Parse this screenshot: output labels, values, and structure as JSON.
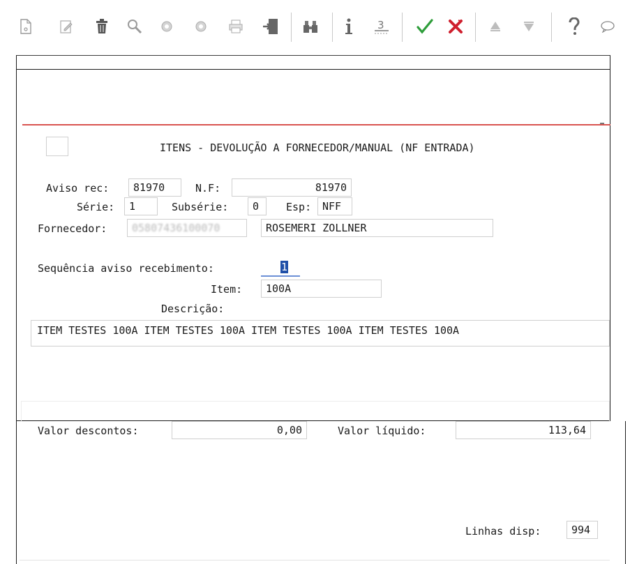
{
  "toolbar": {
    "icons": [
      "new-document-icon",
      "edit-icon",
      "delete-icon",
      "search-icon",
      "previous-icon",
      "next-icon",
      "print-icon",
      "exit-icon",
      "binoculars-icon",
      "info-icon",
      "list-icon",
      "confirm-icon",
      "cancel-icon",
      "move-up-icon",
      "move-down-icon",
      "help-icon",
      "chat-icon"
    ],
    "colors": {
      "confirm": "#2e9d3a",
      "cancel": "#cf1f2e",
      "icon_gray": "#8a8a8a"
    }
  },
  "form": {
    "title": "ITENS - DEVOLUÇÃO A FORNECEDOR/MANUAL (NF ENTRADA)",
    "aviso_rec_label": "Aviso rec:",
    "aviso_rec_value": "81970",
    "nf_label": "N.F:",
    "nf_value": "81970",
    "serie_label": "Série:",
    "serie_value": "1",
    "subserie_label": "Subsérie:",
    "subserie_value": "0",
    "esp_label": "Esp:",
    "esp_value": "NFF",
    "fornecedor_label": "Fornecedor:",
    "fornecedor_code": "05807436100070",
    "fornecedor_name": "ROSEMERI ZOLLNER",
    "sequencia_label": "Sequência aviso recebimento:",
    "sequencia_value": "1",
    "item_label": "Item:",
    "item_value": "100A",
    "descricao_label": "Descrição:",
    "descricao_value": "ITEM TESTES 100A ITEM TESTES 100A ITEM TESTES 100A ITEM TESTES 100A"
  },
  "totals": {
    "valor_descontos_label": "Valor descontos:",
    "valor_descontos_value": "0,00",
    "valor_liquido_label": "Valor líquido:",
    "valor_liquido_value": "113,64",
    "linhas_disp_label": "Linhas disp:",
    "linhas_disp_value": "994"
  }
}
